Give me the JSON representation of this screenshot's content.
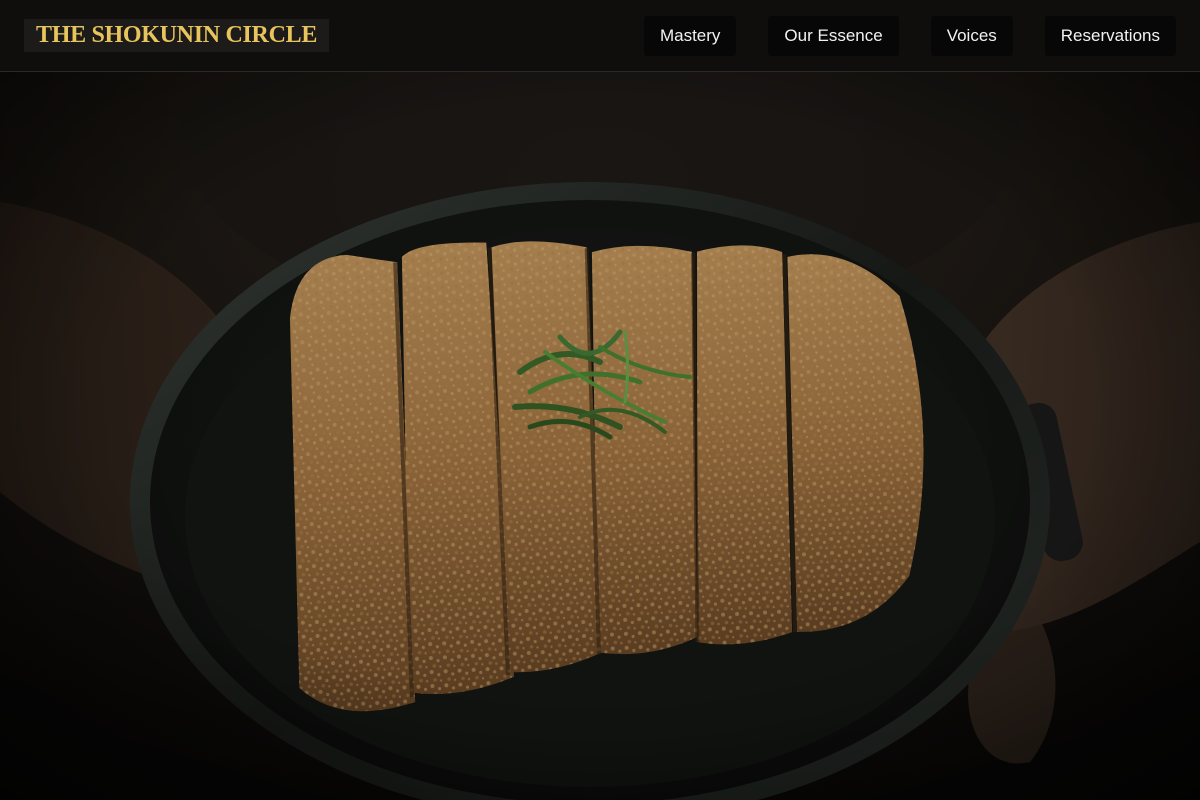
{
  "header": {
    "brand": "THE SHOKUNIN CIRCLE",
    "nav": [
      {
        "label": "Mastery"
      },
      {
        "label": "Our Essence"
      },
      {
        "label": "Voices"
      },
      {
        "label": "Reservations"
      }
    ]
  },
  "hero": {
    "image_subject": "katsu-in-dark-bowl",
    "accent_color": "#e7c45c"
  },
  "colors": {
    "header_bg": "#0f0e0d",
    "brand_bg": "#1d1b19",
    "brand_text": "#e7c45c",
    "nav_bg": "#070707",
    "nav_text": "#f2f2f2"
  }
}
